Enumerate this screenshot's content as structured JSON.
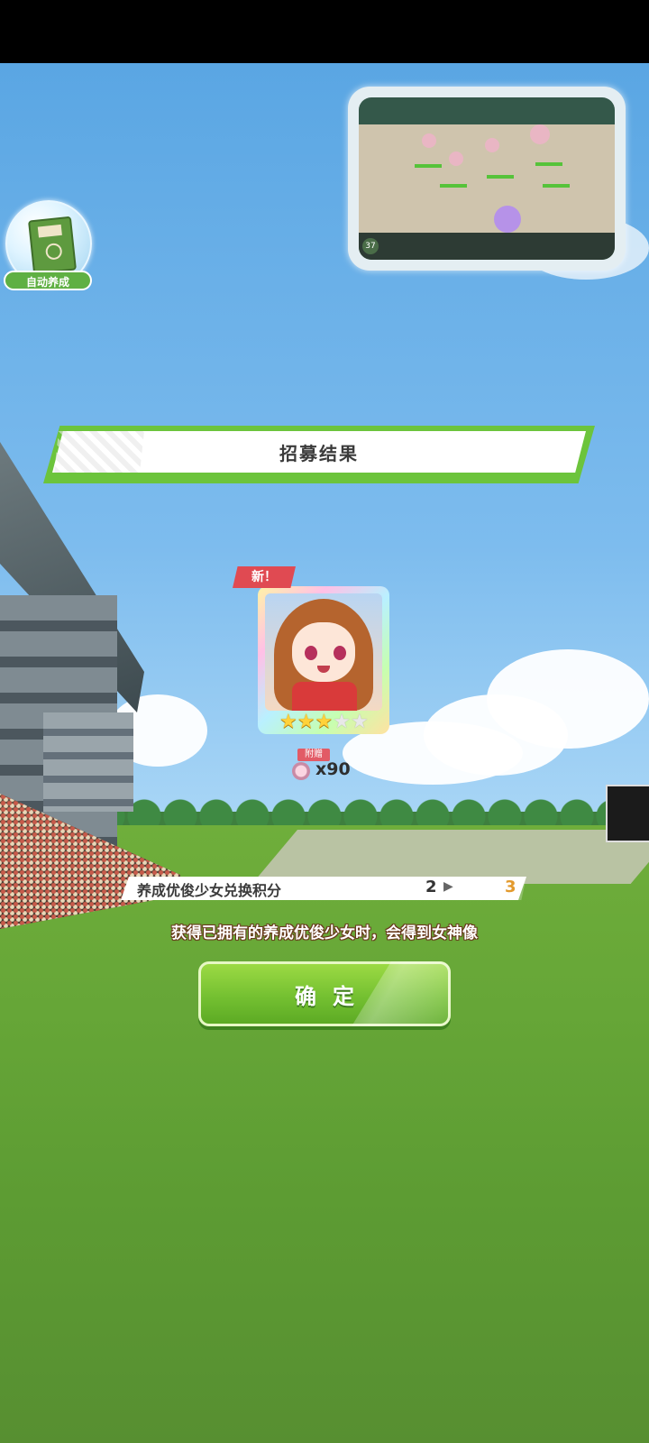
{
  "auto_train": {
    "label": "自动养成",
    "icon": "book-icon"
  },
  "minimap": {
    "level_badge": "37"
  },
  "result": {
    "title": "招募结果",
    "new_badge": "新！",
    "card": {
      "rarity_stars_filled": 3,
      "rarity_stars_total": 5,
      "bonus_tag": "附赠",
      "bonus_quantity": "x90"
    }
  },
  "points": {
    "label": "养成优俊少女兑换积分",
    "from": "2",
    "to": "3",
    "arrow_icon": "triangle-right-icon"
  },
  "notice": "获得已拥有的养成优俊少女时，会得到女神像",
  "confirm_button": {
    "label": "确定"
  },
  "colors": {
    "accent_green": "#6cc43c",
    "new_badge_red": "#e04a52",
    "points_highlight": "#e39a2d",
    "star_gold": "#ffd23a"
  }
}
